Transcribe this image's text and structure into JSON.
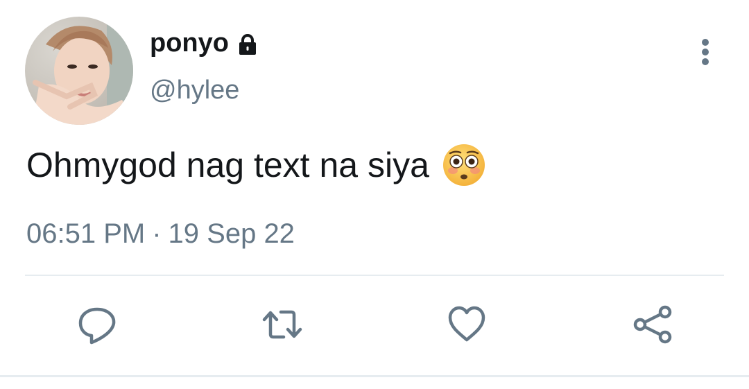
{
  "user": {
    "display_name": "ponyo",
    "handle": "@hylee",
    "protected_icon": "lock-icon",
    "avatar": "profile-photo"
  },
  "tweet": {
    "text": "Ohmygod nag text na siya",
    "emoji": "flushed-face-emoji",
    "time": "06:51 PM",
    "separator": "·",
    "date": "19 Sep 22"
  },
  "header": {
    "more_icon": "more-vertical-icon"
  },
  "actions": [
    {
      "icon": "reply-icon"
    },
    {
      "icon": "retweet-icon"
    },
    {
      "icon": "like-icon"
    },
    {
      "icon": "share-icon"
    }
  ],
  "colors": {
    "text_primary": "#14171a",
    "text_secondary": "#657786",
    "divider": "#e6ecf0",
    "icon": "#657786"
  }
}
